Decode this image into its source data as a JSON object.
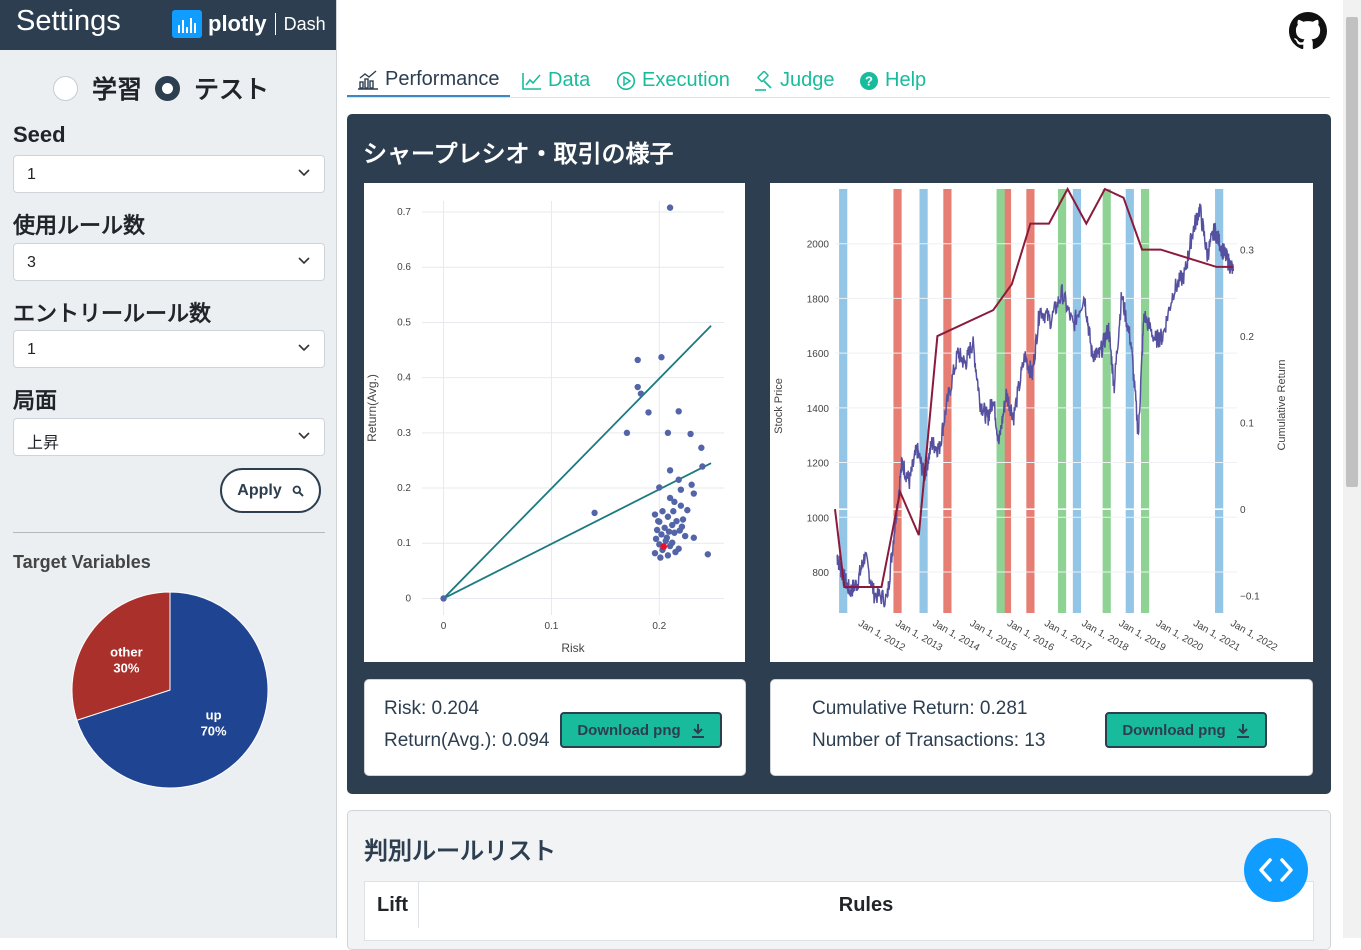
{
  "sidebar": {
    "title": "Settings",
    "logo_main": "plotly",
    "logo_sub": "Dash",
    "mode_options": [
      {
        "label": "学習",
        "selected": false
      },
      {
        "label": "テスト",
        "selected": true
      }
    ],
    "seed": {
      "label": "Seed",
      "value": "1"
    },
    "rules_count": {
      "label": "使用ルール数",
      "value": "3"
    },
    "entry_rules": {
      "label": "エントリールール数",
      "value": "1"
    },
    "phase": {
      "label": "局面",
      "value": "上昇"
    },
    "apply_label": "Apply",
    "target_title": "Target Variables",
    "pie": {
      "slices": [
        {
          "name": "up",
          "pct_label": "70%",
          "value": 70,
          "color": "#1f4491"
        },
        {
          "name": "other",
          "pct_label": "30%",
          "value": 30,
          "color": "#a9302b"
        }
      ]
    }
  },
  "tabs": [
    {
      "label": "Performance",
      "icon": "chart-bar-icon",
      "active": true
    },
    {
      "label": "Data",
      "icon": "chart-line-icon",
      "active": false
    },
    {
      "label": "Execution",
      "icon": "play-circle-icon",
      "active": false
    },
    {
      "label": "Judge",
      "icon": "gavel-icon",
      "active": false
    },
    {
      "label": "Help",
      "icon": "question-circle-icon",
      "active": false
    }
  ],
  "performance": {
    "title": "シャープレシオ・取引の様子",
    "risk_text": "Risk: 0.204",
    "return_text": "Return(Avg.): 0.094",
    "cum_text": "Cumulative Return: 0.281",
    "tx_text": "Number of Transactions: 13",
    "download_label": "Download png"
  },
  "rules_section": {
    "title": "判別ルールリスト",
    "col_lift": "Lift",
    "col_rules": "Rules"
  },
  "chart_data": [
    {
      "type": "scatter",
      "xlabel": "Risk",
      "ylabel": "Return(Avg.)",
      "xlim": [
        -0.02,
        0.26
      ],
      "ylim": [
        -0.03,
        0.72
      ],
      "xticks": [
        0,
        0.1,
        0.2
      ],
      "yticks": [
        0,
        0.1,
        0.2,
        0.3,
        0.4,
        0.5,
        0.6,
        0.7
      ],
      "points": [
        [
          0.21,
          0.708
        ],
        [
          0.18,
          0.432
        ],
        [
          0.202,
          0.437
        ],
        [
          0.18,
          0.383
        ],
        [
          0.183,
          0.371
        ],
        [
          0.19,
          0.337
        ],
        [
          0.218,
          0.339
        ],
        [
          0.17,
          0.3
        ],
        [
          0.208,
          0.3
        ],
        [
          0.229,
          0.298
        ],
        [
          0.239,
          0.273
        ],
        [
          0.24,
          0.239
        ],
        [
          0.21,
          0.232
        ],
        [
          0.218,
          0.215
        ],
        [
          0.2,
          0.201
        ],
        [
          0.22,
          0.197
        ],
        [
          0.23,
          0.206
        ],
        [
          0.14,
          0.155
        ],
        [
          0.232,
          0.19
        ],
        [
          0.21,
          0.182
        ],
        [
          0.214,
          0.175
        ],
        [
          0.22,
          0.168
        ],
        [
          0.226,
          0.16
        ],
        [
          0.203,
          0.158
        ],
        [
          0.196,
          0.152
        ],
        [
          0.208,
          0.148
        ],
        [
          0.216,
          0.14
        ],
        [
          0.2,
          0.139
        ],
        [
          0.212,
          0.133
        ],
        [
          0.221,
          0.13
        ],
        [
          0.205,
          0.128
        ],
        [
          0.198,
          0.124
        ],
        [
          0.209,
          0.121
        ],
        [
          0.214,
          0.119
        ],
        [
          0.202,
          0.116
        ],
        [
          0.224,
          0.113
        ],
        [
          0.197,
          0.108
        ],
        [
          0.206,
          0.104
        ],
        [
          0.212,
          0.101
        ],
        [
          0.232,
          0.11
        ],
        [
          0.2,
          0.098
        ],
        [
          0.21,
          0.095
        ],
        [
          0.218,
          0.09
        ],
        [
          0.203,
          0.088
        ],
        [
          0.196,
          0.082
        ],
        [
          0.208,
          0.078
        ],
        [
          0.201,
          0.074
        ],
        [
          0.215,
          0.084
        ],
        [
          0.245,
          0.08
        ],
        [
          0.222,
          0.143
        ],
        [
          0.213,
          0.158
        ],
        [
          0.207,
          0.11
        ],
        [
          0.219,
          0.123
        ],
        [
          0.199,
          0.14
        ]
      ],
      "highlight": [
        0.204,
        0.094
      ],
      "lines": [
        [
          [
            0,
            0
          ],
          [
            0.248,
            0.494
          ]
        ],
        [
          [
            0,
            0
          ],
          [
            0.248,
            0.245
          ]
        ]
      ]
    },
    {
      "type": "line",
      "ylabel": "Stock Price",
      "y2label": "Cumulative Return",
      "xlim": [
        2011.5,
        2022.3
      ],
      "ylim": [
        650,
        2200
      ],
      "y2lim": [
        -0.12,
        0.37
      ],
      "xticks": [
        "Jan 1, 2012",
        "Jan 1, 2013",
        "Jan 1, 2014",
        "Jan 1, 2015",
        "Jan 1, 2016",
        "Jan 1, 2017",
        "Jan 1, 2018",
        "Jan 1, 2019",
        "Jan 1, 2020",
        "Jan 1, 2021",
        "Jan 1, 2022"
      ],
      "yticks": [
        800,
        1000,
        1200,
        1400,
        1600,
        1800,
        2000
      ],
      "y2ticks": [
        -0.1,
        0,
        0.1,
        0.2,
        0.3
      ],
      "price_anchors": [
        [
          2011.55,
          860
        ],
        [
          2011.7,
          790
        ],
        [
          2011.9,
          730
        ],
        [
          2012.1,
          760
        ],
        [
          2012.3,
          860
        ],
        [
          2012.55,
          720
        ],
        [
          2012.9,
          700
        ],
        [
          2013.1,
          960
        ],
        [
          2013.3,
          1200
        ],
        [
          2013.5,
          1130
        ],
        [
          2013.7,
          1250
        ],
        [
          2013.9,
          1150
        ],
        [
          2014.1,
          1270
        ],
        [
          2014.3,
          1250
        ],
        [
          2014.5,
          1410
        ],
        [
          2014.8,
          1600
        ],
        [
          2015.0,
          1560
        ],
        [
          2015.2,
          1640
        ],
        [
          2015.4,
          1420
        ],
        [
          2015.6,
          1360
        ],
        [
          2015.75,
          1440
        ],
        [
          2015.9,
          1270
        ],
        [
          2016.1,
          1450
        ],
        [
          2016.3,
          1370
        ],
        [
          2016.6,
          1590
        ],
        [
          2016.8,
          1520
        ],
        [
          2017.0,
          1760
        ],
        [
          2017.3,
          1720
        ],
        [
          2017.6,
          1820
        ],
        [
          2017.9,
          1700
        ],
        [
          2018.2,
          1810
        ],
        [
          2018.4,
          1600
        ],
        [
          2018.6,
          1590
        ],
        [
          2018.85,
          1690
        ],
        [
          2019.0,
          1480
        ],
        [
          2019.2,
          1810
        ],
        [
          2019.45,
          1640
        ],
        [
          2019.65,
          1300
        ],
        [
          2019.8,
          1740
        ],
        [
          2020.1,
          1650
        ],
        [
          2020.3,
          1660
        ],
        [
          2020.6,
          1830
        ],
        [
          2020.9,
          1890
        ],
        [
          2021.1,
          2040
        ],
        [
          2021.3,
          2130
        ],
        [
          2021.5,
          1960
        ],
        [
          2021.7,
          2050
        ],
        [
          2021.9,
          1980
        ],
        [
          2022.05,
          1940
        ],
        [
          2022.2,
          1900
        ]
      ],
      "cum_steps": [
        [
          2011.5,
          0
        ],
        [
          2011.75,
          -0.09
        ],
        [
          2012.75,
          -0.09
        ],
        [
          2013.25,
          0.02
        ],
        [
          2013.75,
          -0.03
        ],
        [
          2014.25,
          0.2
        ],
        [
          2015.75,
          0.23
        ],
        [
          2016.25,
          0.26
        ],
        [
          2016.75,
          0.33
        ],
        [
          2017.25,
          0.33
        ],
        [
          2017.75,
          0.37
        ],
        [
          2018.25,
          0.33
        ],
        [
          2018.75,
          0.37
        ],
        [
          2019.25,
          0.36
        ],
        [
          2019.75,
          0.3
        ],
        [
          2020.25,
          0.3
        ],
        [
          2021.75,
          0.28
        ],
        [
          2022.2,
          0.28
        ]
      ],
      "bands_blue": [
        2011.72,
        2013.88,
        2018.0,
        2019.42,
        2021.82
      ],
      "bands_red": [
        2013.18,
        2014.52,
        2016.12,
        2016.75
      ],
      "bands_green": [
        2015.95,
        2017.6,
        2018.8,
        2019.83
      ],
      "colors": {
        "price": "#5551a0",
        "cum": "#8b1a3c",
        "blue": "#92c5e6",
        "red": "#e67e73",
        "green": "#8fd394"
      }
    }
  ]
}
